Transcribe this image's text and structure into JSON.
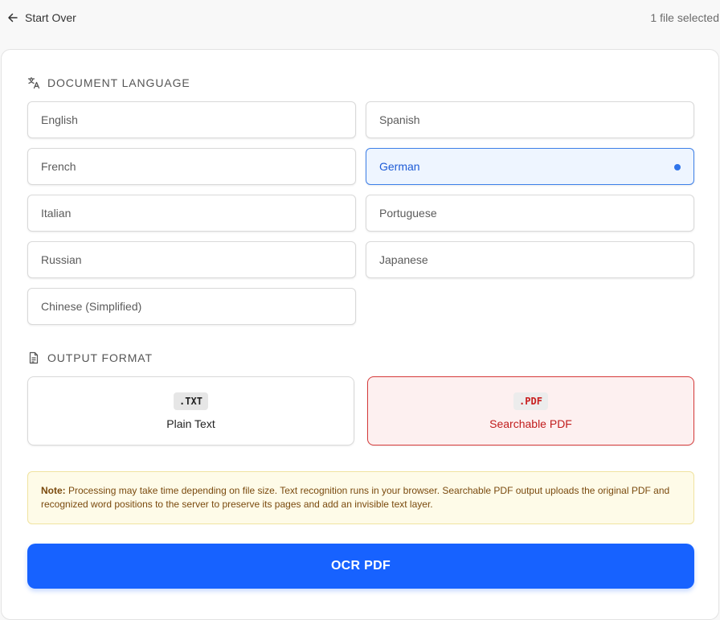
{
  "topbar": {
    "back_label": "Start Over",
    "file_count": "1 file selected"
  },
  "language_section": {
    "title": "DOCUMENT LANGUAGE",
    "icon": "translate-icon",
    "selected": "German",
    "options": [
      "English",
      "Spanish",
      "French",
      "German",
      "Italian",
      "Portuguese",
      "Russian",
      "Japanese",
      "Chinese (Simplified)"
    ]
  },
  "format_section": {
    "title": "OUTPUT FORMAT",
    "icon": "document-icon",
    "selected": "pdf",
    "options": [
      {
        "ext": ".TXT",
        "label": "Plain Text"
      },
      {
        "ext": ".PDF",
        "label": "Searchable PDF"
      }
    ]
  },
  "note": {
    "prefix": "Note:",
    "text": " Processing may take time depending on file size. Text recognition runs in your browser. Searchable PDF output uploads the original PDF and recognized word positions to the server to preserve its pages and add an invisible text layer."
  },
  "action": {
    "button_label": "OCR PDF"
  },
  "colors": {
    "primary": "#1762ff",
    "selected_language_border": "#3d7fe8",
    "selected_format_border": "#d63a3a",
    "note_background": "#fefbe8"
  }
}
